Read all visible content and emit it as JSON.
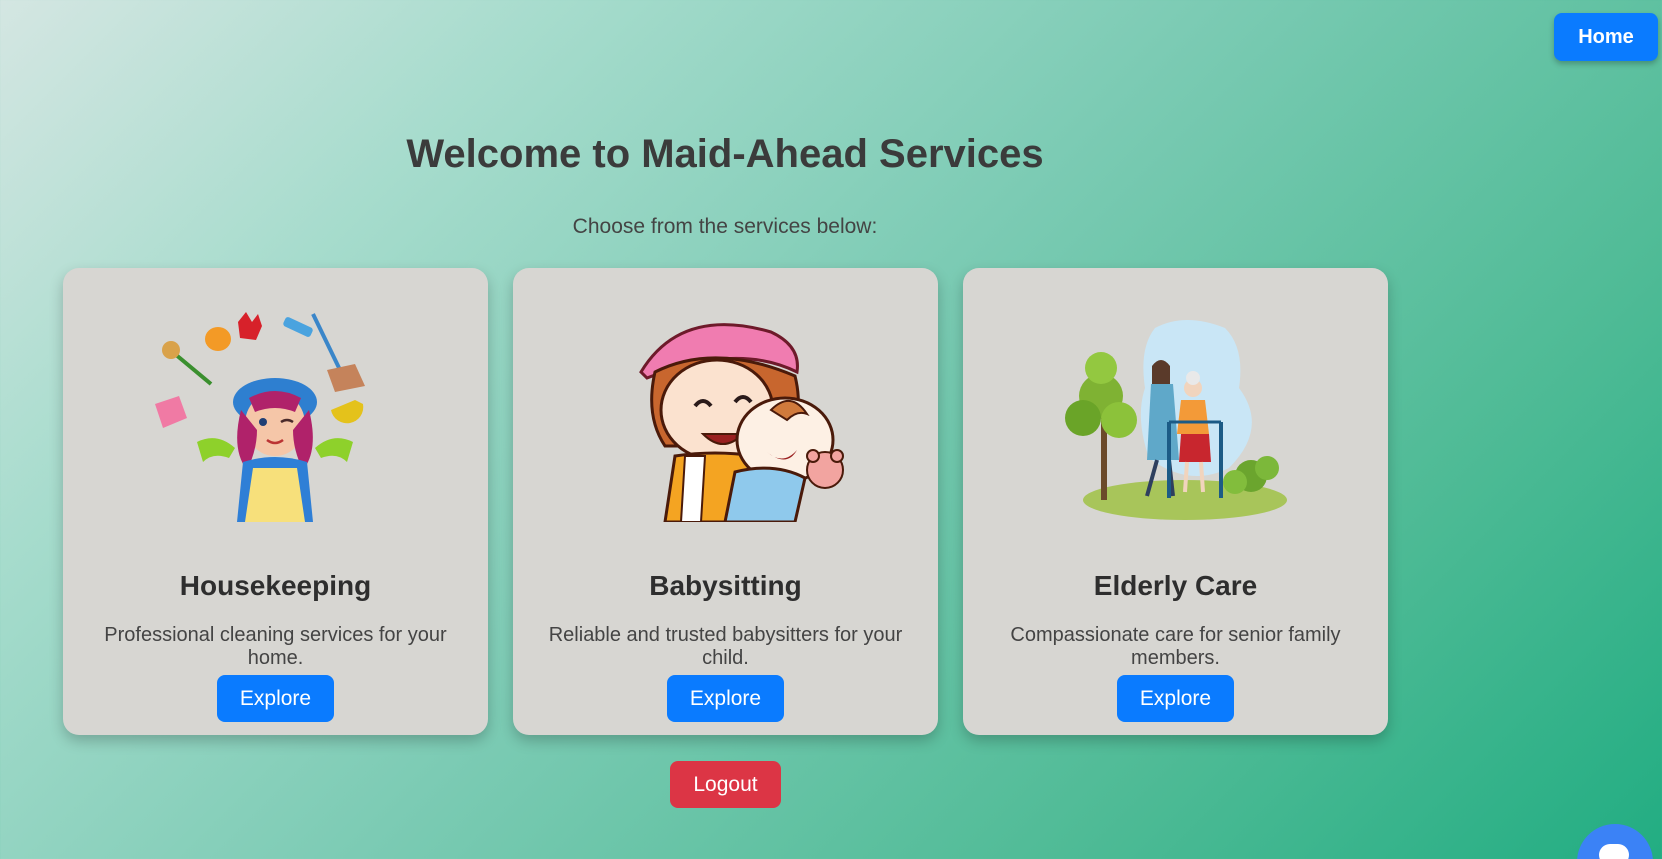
{
  "nav": {
    "home_label": "Home"
  },
  "header": {
    "title": "Welcome to Maid-Ahead Services",
    "subtitle": "Choose from the services below:"
  },
  "services": [
    {
      "title": "Housekeeping",
      "description": "Professional cleaning services for your home.",
      "button_label": "Explore",
      "illustration": "housekeeper-illustration"
    },
    {
      "title": "Babysitting",
      "description": "Reliable and trusted babysitters for your child.",
      "button_label": "Explore",
      "illustration": "babysitter-illustration"
    },
    {
      "title": "Elderly Care",
      "description": "Compassionate care for senior family members.",
      "button_label": "Explore",
      "illustration": "elderly-care-illustration"
    }
  ],
  "logout_label": "Logout",
  "chat": {
    "icon": "chat-icon"
  },
  "colors": {
    "primary": "#0a7bff",
    "danger": "#dc3545",
    "card_bg": "#d7d6d2",
    "gradient_start": "#d4e6e2",
    "gradient_end": "#22ad82"
  }
}
